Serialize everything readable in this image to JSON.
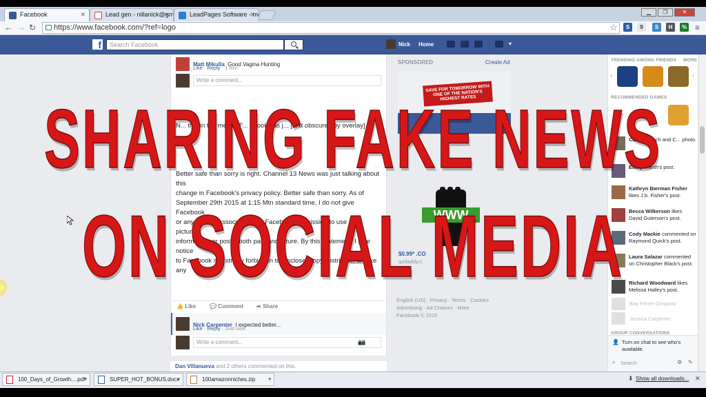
{
  "browser": {
    "tabs": [
      {
        "label": "Facebook",
        "color": "#3b5998"
      },
      {
        "label": "Lead gen - nillanick@gm",
        "color": "#d23f31"
      },
      {
        "label": "LeadPages Software - mo",
        "color": "#2a7fd4"
      }
    ],
    "url": "https://www.facebook.com/?ref=logo",
    "window_buttons": [
      "minimize",
      "restore",
      "close"
    ]
  },
  "facebook": {
    "logo": "f",
    "search_placeholder": "Search Facebook",
    "user_name": "Nick",
    "home_label": "Home"
  },
  "feed": {
    "comments_top": [
      {
        "name": "Matt Mikulla",
        "text": "Good Vagina Hunting",
        "like": "Like",
        "reply": "Reply",
        "time": "1 min"
      }
    ],
    "write_comment": "Write a comment...",
    "post_text_visible": "N... this in the media. F... ebook has j... [text obscured by overlay]",
    "post_lines": [
      "Better safe than sorry is right. Channel 13 News was just talking about this",
      "change in Facebook's privacy policy. Better safe than sorry. As of",
      "September 29th 2015 at 1:15 Mtn standard time, I do not give Facebook",
      "or any entities associated with Facebook permission to use my pictures,",
      "information, or posts, both past and future. By this statement, I give notice",
      "to Facebook it is strictly forbidden to disclose, copy, distribute, or take any"
    ],
    "actions": {
      "like": "Like",
      "comment": "Comment",
      "share": "Share"
    },
    "comment_bottom": {
      "name": "Nick Carpenter",
      "text": "I expected better...",
      "like": "Like",
      "reply": "Reply",
      "time": "Just now"
    },
    "next_post": {
      "name": "Dan Villanueva",
      "text": "and 2 others commented on this."
    }
  },
  "ads": {
    "sponsored": "SPONSORED",
    "create_ad": "Create Ad",
    "banner_text": "SAVE FOR TOMORROW WITH ONE OF THE NATION'S HIGHEST RATES",
    "price": "$0.99* .CO",
    "domain": "godaddy.c",
    "footer_lines": [
      "English (US) · Privacy · Terms · Cookies",
      "Advertising · Ad Choices · More",
      "Facebook © 2015"
    ],
    "www_logo": "WWW"
  },
  "sidebar": {
    "trending_title": "TRENDING AMONG FRIENDS",
    "more": "MORE",
    "recommended_title": "RECOMMENDED GAMES",
    "group_title": "GROUP CONVERSATIONS",
    "ticker": [
      {
        "name": "Carla",
        "text": "Cheech and C... photo."
      },
      {
        "name": "Emily",
        "text": "Marsh's post."
      },
      {
        "name": "Kathryn Bierman Fisher",
        "text": "likes J.b. Fisher's post."
      },
      {
        "name": "Becca Wilkerson",
        "text": "likes David Guterson's post."
      },
      {
        "name": "Cody Mackie",
        "text": "commented on Raymond Quick's post."
      },
      {
        "name": "Laura Salazar",
        "text": "commented on Christopher Black's post."
      },
      {
        "name": "Richard Woodward",
        "text": "likes Melissa Halley's post."
      }
    ],
    "chat_names": [
      "Bay Ferrer-Dimpano",
      "Jessica Carpenter"
    ],
    "chat_notice": "Turn on chat to see who's available.",
    "chat_search": "Search"
  },
  "downloads": {
    "items": [
      "100_Days_of_Growth....pdf",
      "SUPER_HOT_BONUS.docx",
      "100amazonniches.zip"
    ],
    "show_all": "Show all downloads..."
  },
  "overlay": {
    "line1": "SHARING FAKE NEWS",
    "line2": "ON SOCIAL MEDIA",
    "color": "#d71717"
  }
}
